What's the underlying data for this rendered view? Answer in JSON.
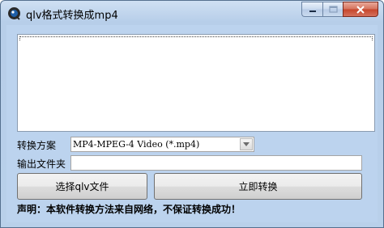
{
  "window": {
    "title": "qlv格式转换成mp4",
    "icon": "app-logo-icon",
    "caption_buttons": [
      "minimize-icon",
      "maximize-icon",
      "close-icon"
    ]
  },
  "file_list": {
    "items": []
  },
  "scheme": {
    "label": "转换方案",
    "selected": "MP4-MPEG-4 Video (*.mp4)"
  },
  "output": {
    "label": "输出文件夹",
    "value": ""
  },
  "buttons": {
    "select_label": "选择qlv文件",
    "convert_label": "立即转换"
  },
  "footer": {
    "note": "声明：本软件转换方法来自网络，不保证转换成功！"
  }
}
